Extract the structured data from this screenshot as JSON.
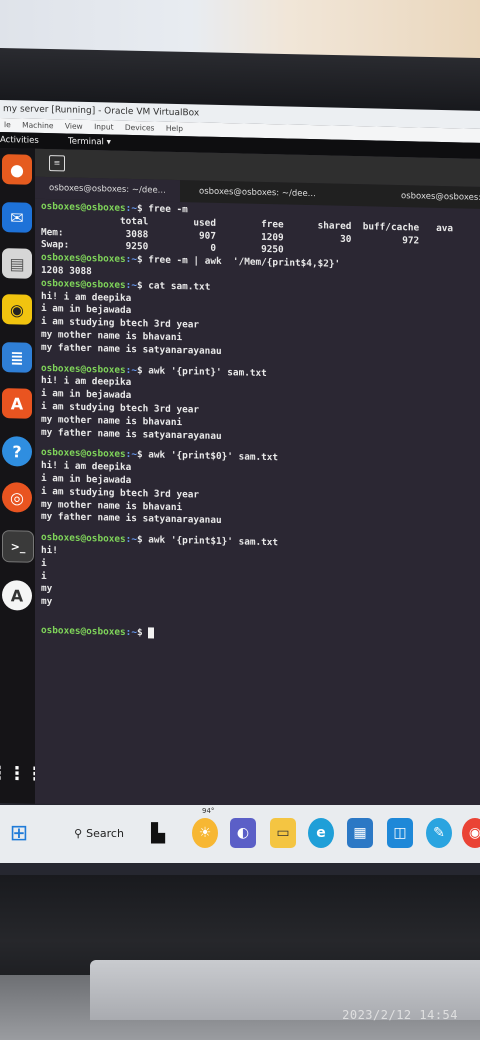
{
  "vbox": {
    "title": "my server [Running] - Oracle VM VirtualBox",
    "menu": [
      "le",
      "Machine",
      "View",
      "Input",
      "Devices",
      "Help"
    ]
  },
  "gnome": {
    "activities": "Activities",
    "terminal_label": "Terminal ▾"
  },
  "terminal": {
    "tabs": [
      "osboxes@osboxes: ~/dee...",
      "osboxes@osboxes: ~/dee...",
      "osboxes@osboxes:"
    ],
    "lines": [
      {
        "prompt": "osboxes@osboxes",
        "path": ":~",
        "cmd": "$ free -m"
      },
      {
        "text": "              total        used        free      shared  buff/cache   ava"
      },
      {
        "text": "Mem:           3088         907        1209          30         972"
      },
      {
        "text": "Swap:          9250           0        9250"
      },
      {
        "prompt": "osboxes@osboxes",
        "path": ":~",
        "cmd": "$ free -m | awk  '/Mem/{print$4,$2}'"
      },
      {
        "text": "1208 3088"
      },
      {
        "prompt": "osboxes@osboxes",
        "path": ":~",
        "cmd": "$ cat sam.txt"
      },
      {
        "text": "hi! i am deepika"
      },
      {
        "text": "i am in bejawada"
      },
      {
        "text": "i am studying btech 3rd year"
      },
      {
        "text": "my mother name is bhavani"
      },
      {
        "text": "my father name is satyanarayanau"
      },
      {
        "gap": true
      },
      {
        "prompt": "osboxes@osboxes",
        "path": ":~",
        "cmd": "$ awk '{print}' sam.txt"
      },
      {
        "text": "hi! i am deepika"
      },
      {
        "text": "i am in bejawada"
      },
      {
        "text": "i am studying btech 3rd year"
      },
      {
        "text": "my mother name is bhavani"
      },
      {
        "text": "my father name is satyanarayanau"
      },
      {
        "gap": true
      },
      {
        "prompt": "osboxes@osboxes",
        "path": ":~",
        "cmd": "$ awk '{print$0}' sam.txt"
      },
      {
        "text": "hi! i am deepika"
      },
      {
        "text": "i am in bejawada"
      },
      {
        "text": "i am studying btech 3rd year"
      },
      {
        "text": "my mother name is bhavani"
      },
      {
        "text": "my father name is satyanarayanau"
      },
      {
        "gap": true
      },
      {
        "prompt": "osboxes@osboxes",
        "path": ":~",
        "cmd": "$ awk '{print$1}' sam.txt"
      },
      {
        "text": "hi!"
      },
      {
        "text": "i"
      },
      {
        "text": "i"
      },
      {
        "text": "my"
      },
      {
        "text": "my"
      },
      {
        "gap": true
      },
      {
        "gap": true
      },
      {
        "prompt": "osboxes@osboxes",
        "path": ":~",
        "cmd": "$ ",
        "cursor": true
      }
    ]
  },
  "taskbar": {
    "search_label": "Search",
    "temperature": "94°"
  },
  "photo": {
    "timestamp": "2023/2/12  14:54"
  },
  "colors": {
    "prompt": "#7fd45a",
    "path": "#6a9ef5",
    "terminal_bg": "#2b2733"
  }
}
